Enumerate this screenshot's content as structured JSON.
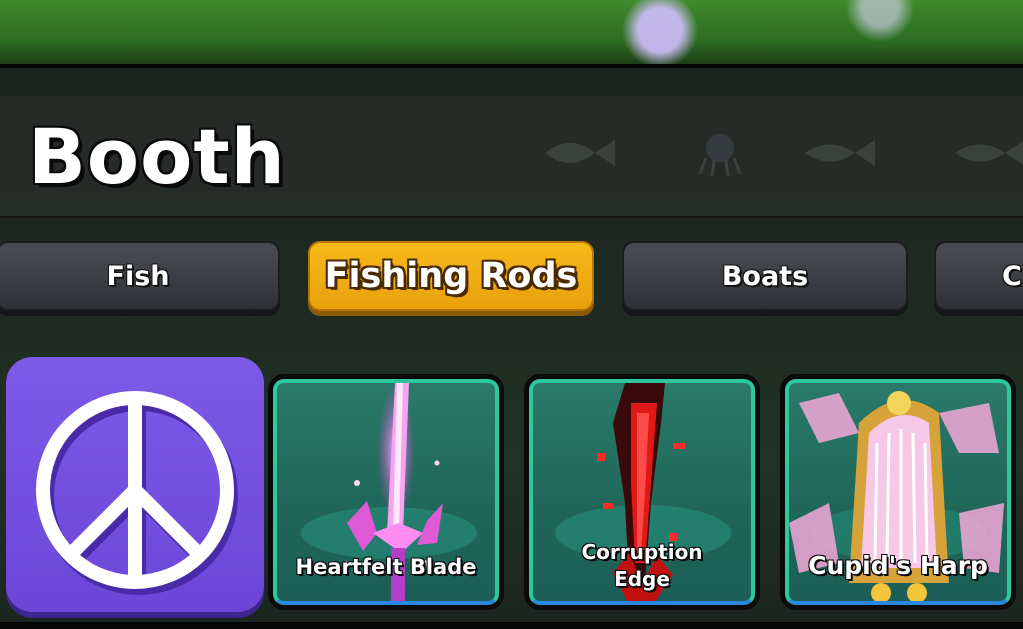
{
  "booth": {
    "title": "Booth"
  },
  "tabs": [
    {
      "label": "Fish",
      "active": false
    },
    {
      "label": "Fishing Rods",
      "active": true
    },
    {
      "label": "Boats",
      "active": false
    },
    {
      "label": "C",
      "active": false
    }
  ],
  "items": [
    {
      "name": "Heartfelt Blade",
      "icon": "pink-crystal-sword-icon"
    },
    {
      "name_line1": "Corruption",
      "name_line2": "Edge",
      "icon": "red-glitch-blade-icon"
    },
    {
      "name": "Cupid's Harp",
      "icon": "golden-harp-icon"
    }
  ],
  "peace_button": {
    "icon": "peace-sign-icon"
  },
  "colors": {
    "active_tab": "#f7b91a",
    "tab": "#3c4044",
    "item_border": "#28c3a0",
    "item_bg": "#1f6659",
    "peace_bg": "#7251e0"
  }
}
